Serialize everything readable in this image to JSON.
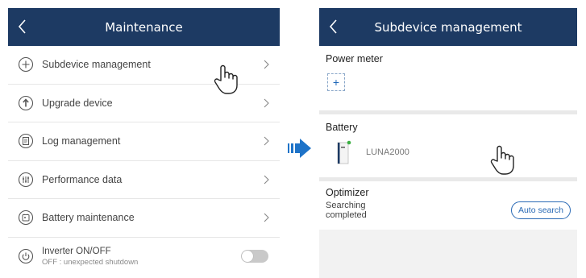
{
  "left_screen": {
    "title": "Maintenance",
    "items": [
      {
        "label": "Subdevice management",
        "icon": "plus-circle-icon"
      },
      {
        "label": "Upgrade device",
        "icon": "upgrade-arrow-icon"
      },
      {
        "label": "Log management",
        "icon": "log-document-icon"
      },
      {
        "label": "Performance data",
        "icon": "performance-sliders-icon"
      },
      {
        "label": "Battery maintenance",
        "icon": "battery-maintenance-icon"
      }
    ],
    "toggle_item": {
      "label": "Inverter ON/OFF",
      "sublabel": "OFF : unexpected shutdown",
      "icon": "power-icon",
      "state": "off"
    }
  },
  "right_screen": {
    "title": "Subdevice management",
    "power_meter": {
      "title": "Power meter",
      "add_label": "+"
    },
    "battery": {
      "title": "Battery",
      "device_name": "LUNA2000"
    },
    "optimizer": {
      "title": "Optimizer",
      "status": "Searching completed",
      "button_label": "Auto search"
    }
  },
  "colors": {
    "titlebar": "#1d3a63",
    "accent": "#2a6ab5",
    "arrow": "#1e73c8",
    "battery_led": "#3cb043"
  }
}
